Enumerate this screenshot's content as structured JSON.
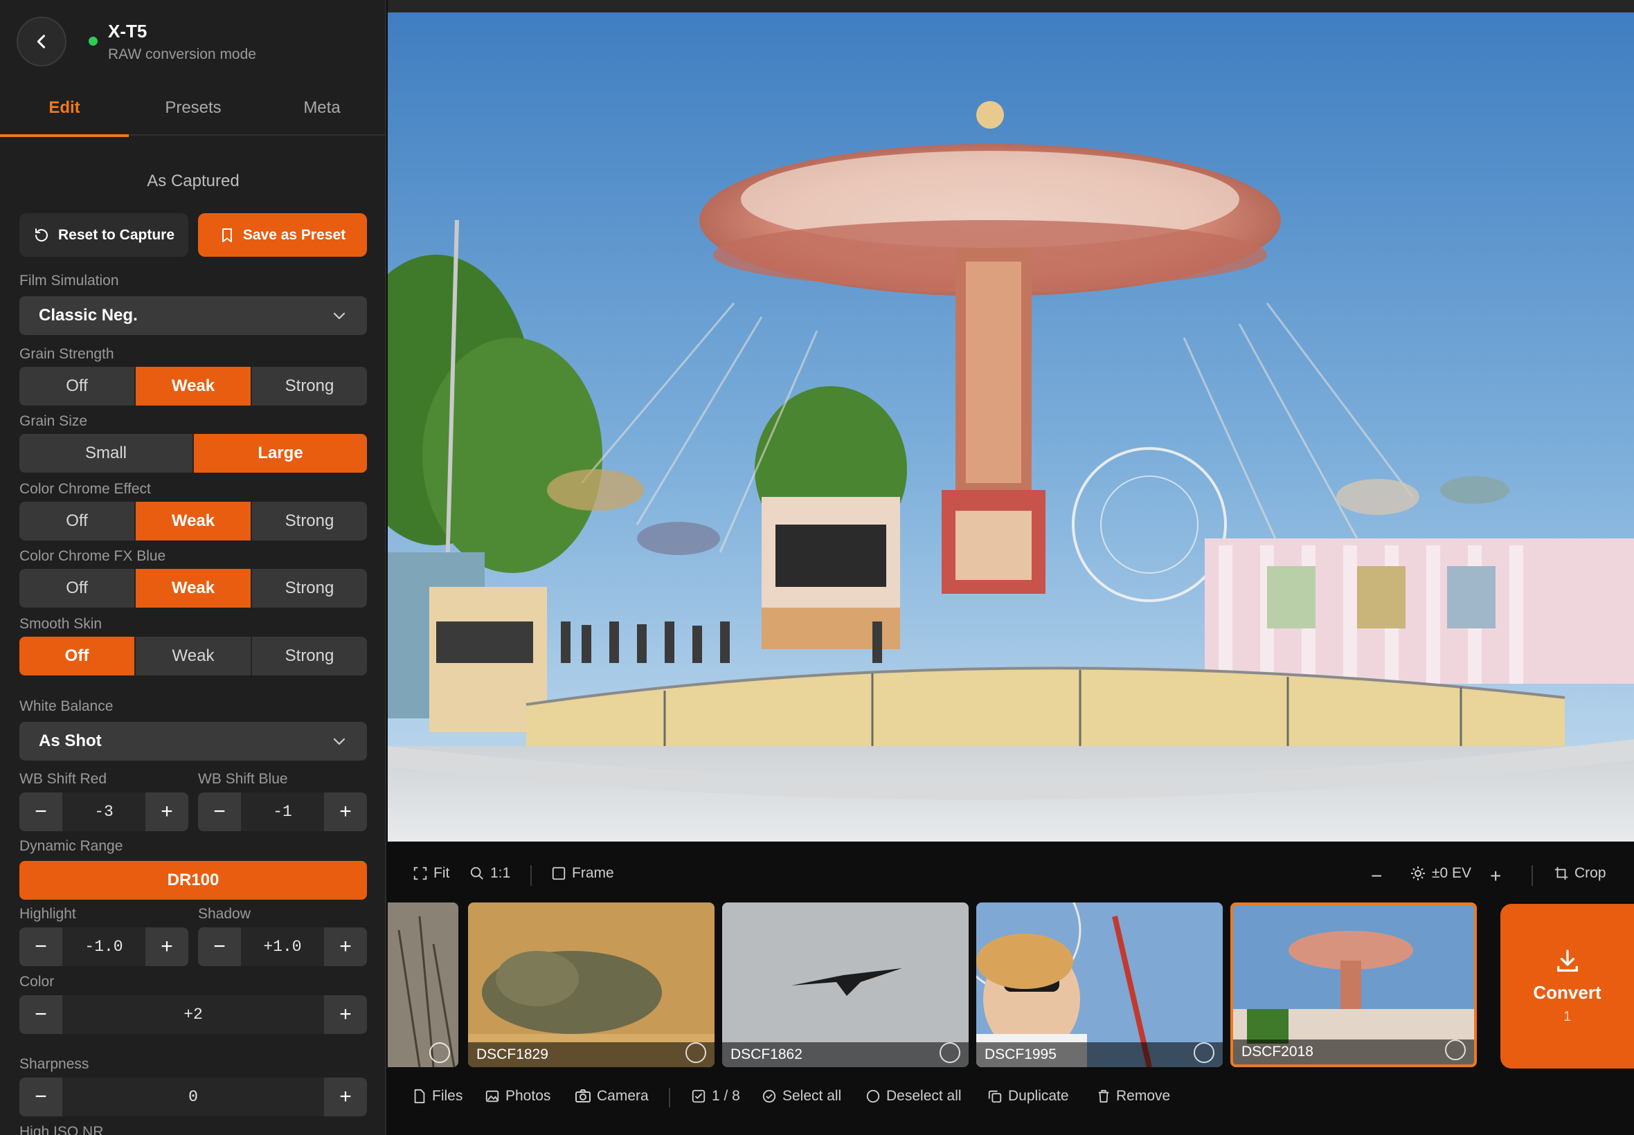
{
  "colors": {
    "accent": "#e85d10",
    "accent_text": "#f07a1c",
    "status_online": "#2ecc55",
    "panel": "#1f1f1f"
  },
  "camera": {
    "name": "X-T5",
    "mode": "RAW conversion mode",
    "status": "online"
  },
  "tabs": [
    {
      "label": "Edit",
      "active": true
    },
    {
      "label": "Presets",
      "active": false
    },
    {
      "label": "Meta",
      "active": false
    }
  ],
  "edit": {
    "preset_name": "As Captured",
    "reset_label": "Reset to Capture",
    "save_label": "Save as Preset",
    "film_simulation": {
      "label": "Film Simulation",
      "value": "Classic Neg."
    },
    "grain_strength": {
      "label": "Grain Strength",
      "options": [
        "Off",
        "Weak",
        "Strong"
      ],
      "selected": "Weak"
    },
    "grain_size": {
      "label": "Grain Size",
      "options": [
        "Small",
        "Large"
      ],
      "selected": "Large"
    },
    "color_chrome": {
      "label": "Color Chrome Effect",
      "options": [
        "Off",
        "Weak",
        "Strong"
      ],
      "selected": "Weak"
    },
    "color_chrome_blue": {
      "label": "Color Chrome FX Blue",
      "options": [
        "Off",
        "Weak",
        "Strong"
      ],
      "selected": "Weak"
    },
    "smooth_skin": {
      "label": "Smooth Skin",
      "options": [
        "Off",
        "Weak",
        "Strong"
      ],
      "selected": "Off"
    },
    "white_balance": {
      "label": "White Balance",
      "value": "As Shot"
    },
    "wb_shift_red": {
      "label": "WB Shift Red",
      "value": "-3"
    },
    "wb_shift_blue": {
      "label": "WB Shift Blue",
      "value": "-1"
    },
    "dynamic_range": {
      "label": "Dynamic Range",
      "value": "DR100"
    },
    "highlight": {
      "label": "Highlight",
      "value": "-1.0"
    },
    "shadow": {
      "label": "Shadow",
      "value": "+1.0"
    },
    "color": {
      "label": "Color",
      "value": "+2"
    },
    "sharpness": {
      "label": "Sharpness",
      "value": "0"
    },
    "high_iso_nr": {
      "label": "High ISO NR"
    }
  },
  "toolbar": {
    "fit": "Fit",
    "zoom": "1:1",
    "frame": "Frame",
    "exposure": "±0 EV",
    "crop": "Crop"
  },
  "filmstrip": [
    {
      "name": "",
      "partial": true,
      "selected": false
    },
    {
      "name": "DSCF1829",
      "selected": false
    },
    {
      "name": "DSCF1862",
      "selected": false
    },
    {
      "name": "DSCF1995",
      "selected": false
    },
    {
      "name": "DSCF2018",
      "selected": true
    }
  ],
  "convert": {
    "label": "Convert",
    "count": "1"
  },
  "bottombar": {
    "files": "Files",
    "photos": "Photos",
    "camera": "Camera",
    "count": "1 / 8",
    "select_all": "Select all",
    "deselect_all": "Deselect all",
    "duplicate": "Duplicate",
    "remove": "Remove"
  }
}
